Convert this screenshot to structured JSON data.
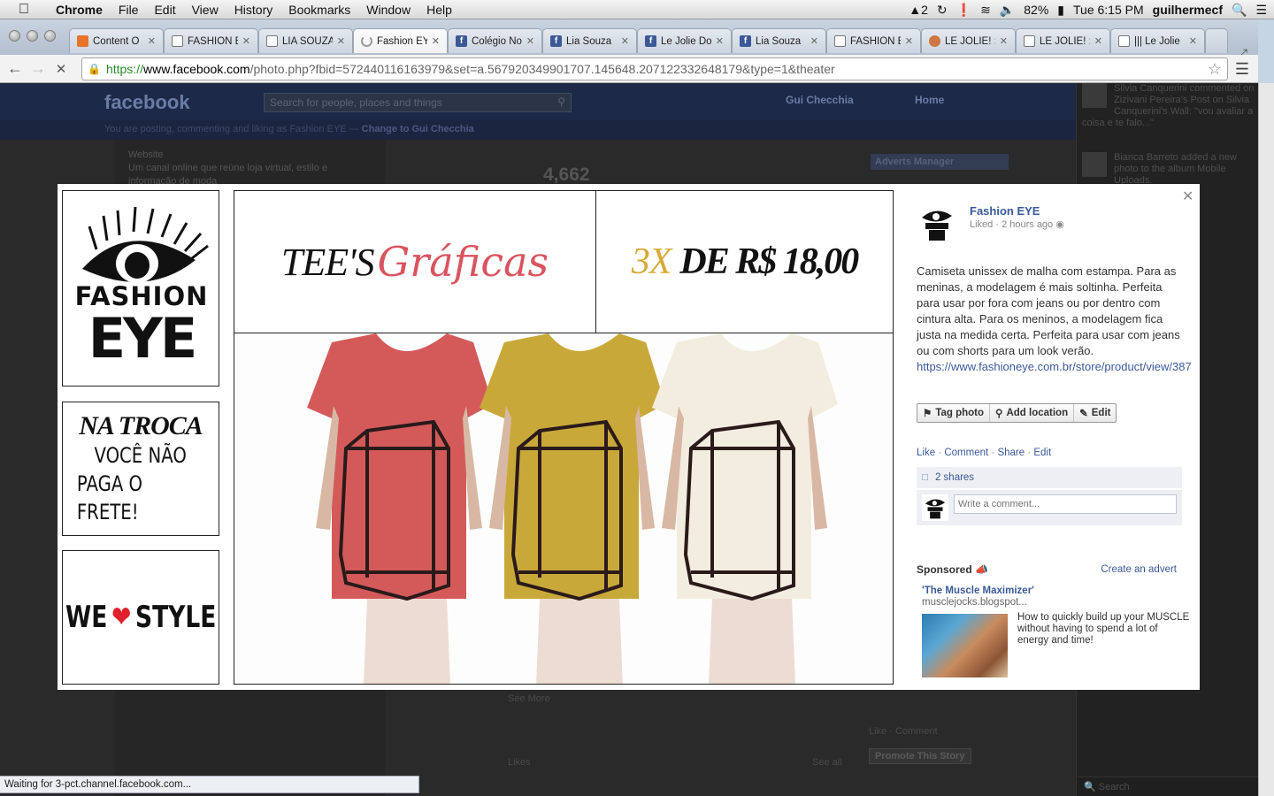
{
  "menubar": {
    "app": "Chrome",
    "items": [
      "File",
      "Edit",
      "View",
      "History",
      "Bookmarks",
      "Window",
      "Help"
    ],
    "adobe_count": "2",
    "battery": "82%",
    "clock": "Tue 6:15 PM",
    "user": "guilhermecf"
  },
  "tabs": [
    {
      "label": "Content O",
      "icon": "co"
    },
    {
      "label": "FASHION E",
      "icon": "doc"
    },
    {
      "label": "LIA SOUZA",
      "icon": "doc"
    },
    {
      "label": "Fashion EY",
      "icon": "spin"
    },
    {
      "label": "Colégio No",
      "icon": "fb"
    },
    {
      "label": "Lia Souza",
      "icon": "fb"
    },
    {
      "label": "Le Jolie Do",
      "icon": "fb"
    },
    {
      "label": "Lia Souza",
      "icon": "fb"
    },
    {
      "label": "FASHION E",
      "icon": "doc"
    },
    {
      "label": "LE JOLIE! :",
      "icon": "lj"
    },
    {
      "label": "LE JOLIE! :C",
      "icon": "doc"
    },
    {
      "label": "||| Le Jolie",
      "icon": "doc"
    }
  ],
  "url": {
    "scheme": "https://",
    "host": "www.facebook.com",
    "path": "/photo.php?fbid=572440116163979&set=a.567920349901707.145648.207122332648179&type=1&theater"
  },
  "fb": {
    "logo": "facebook",
    "search_placeholder": "Search for people, places and things",
    "user": "Gui Checchia",
    "home": "Home",
    "posting_prefix": "You are posting, commenting and liking as Fashion EYE —",
    "posting_link": "Change to Gui Checchia",
    "website_label": "Website",
    "website_text": "Um canal online que reúne loja virtual, estilo e informação de moda",
    "likes_count": "4,662",
    "adverts_btn": "Adverts Manager",
    "see_more": "See More",
    "likes_label": "Likes",
    "see_all": "See all",
    "like_comment": "Like · Comment",
    "promote": "Promote This Story"
  },
  "ticker": [
    {
      "text": "Silvia Canquerini commented on Zizivani Pereira's Post on Silvia Canquerini's Wall: \"vou avaliar a coisa e te falo...\""
    },
    {
      "text": "Bianca Barreto added a new photo to the album Mobile Uploads."
    }
  ],
  "chat": "Search",
  "theater": {
    "brand_top": "FASHION",
    "brand_bottom": "EYE",
    "troca_title": "NA TROCA",
    "troca_line1": "VOCÊ NÃO",
    "troca_line2": "PAGA O FRETE!",
    "style_we": "WE",
    "style_word": "STYLE",
    "tee_word": "TEE'S",
    "tee_script": "Gráficas",
    "price_x": "3X",
    "price_rest": "DE R$ 18,00"
  },
  "side": {
    "author": "Fashion EYE",
    "meta": "Liked · 2 hours ago",
    "caption": "Camiseta unissex de malha com estampa. Para as meninas, a modelagem é mais soltinha. Perfeita para usar por fora com jeans ou por dentro com cintura alta. Para os meninos, a modelagem fica justa na medida certa. Perfeita para usar com jeans ou com shorts para um look verão.",
    "link": "https://www.fashioneye.com.br/store/product/view/387",
    "tag_photo": "Tag photo",
    "add_location": "Add location",
    "edit": "Edit",
    "like": "Like",
    "comment": "Comment",
    "share": "Share",
    "edit2": "Edit",
    "shares": "2 shares",
    "comment_placeholder": "Write a comment...",
    "sponsored": "Sponsored",
    "create_ad": "Create an advert",
    "ad_title": "'The Muscle Maximizer'",
    "ad_url": "musclejocks.blogspot...",
    "ad_text": "How to quickly build up your MUSCLE without having to spend a lot of energy and time!"
  },
  "status": "Waiting for 3-pct.channel.facebook.com...",
  "colors": {
    "fb_blue": "#3b5998",
    "tee_red": "#d45a5a",
    "tee_mustard": "#c9a83a",
    "tee_cream": "#f3ede0",
    "heart": "#e0202c"
  }
}
